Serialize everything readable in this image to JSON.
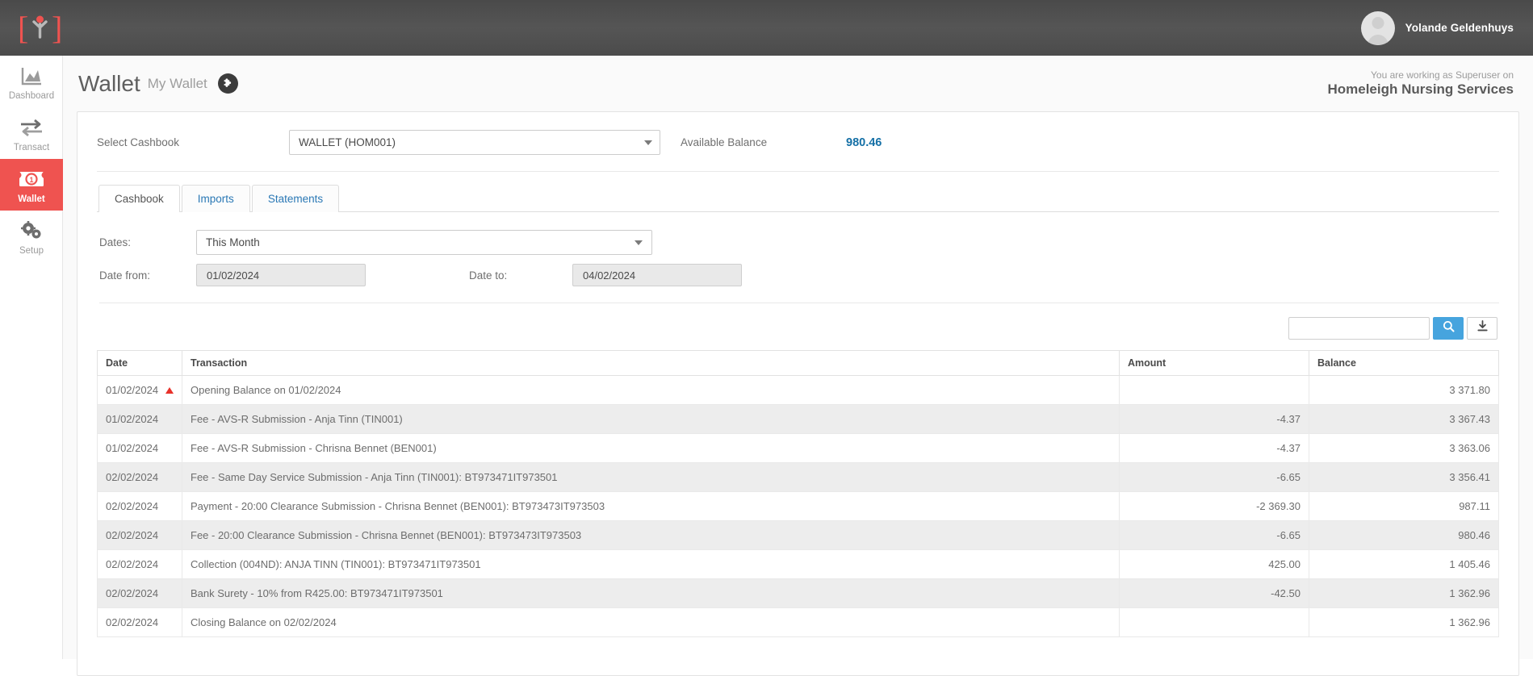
{
  "topbar": {
    "logo_icon": "sage-bracket-logo-icon",
    "user_name": "Yolande Geldenhuys",
    "avatar_icon": "user-avatar-icon"
  },
  "sidebar": {
    "items": [
      {
        "label": "Dashboard",
        "icon": "chart-area-icon",
        "active": false
      },
      {
        "label": "Transact",
        "icon": "exchange-arrows-icon",
        "active": false
      },
      {
        "label": "Wallet",
        "icon": "banknote-icon",
        "active": true
      },
      {
        "label": "Setup",
        "icon": "gears-icon",
        "active": false
      }
    ]
  },
  "page": {
    "title": "Wallet",
    "subtitle": "My Wallet",
    "badge_icon": "puzzle-piece-icon",
    "context_line1": "You are working as Superuser on",
    "context_line2": "Homeleigh Nursing Services"
  },
  "cashbook": {
    "label": "Select Cashbook",
    "selected": "WALLET (HOM001)",
    "balance_label": "Available Balance",
    "balance_value": "980.46",
    "balance_color": "#1570a6"
  },
  "tabs": [
    {
      "label": "Cashbook",
      "active": true
    },
    {
      "label": "Imports",
      "active": false
    },
    {
      "label": "Statements",
      "active": false
    }
  ],
  "filters": {
    "dates_label": "Dates:",
    "dates_value": "This Month",
    "date_from_label": "Date from:",
    "date_from_value": "01/02/2024",
    "date_to_label": "Date to:",
    "date_to_value": "04/02/2024"
  },
  "search": {
    "value": "",
    "placeholder": "",
    "search_icon": "magnifier-icon",
    "export_icon": "download-icon"
  },
  "table": {
    "columns": [
      "Date",
      "Transaction",
      "Amount",
      "Balance"
    ],
    "sort_indicator": "sort-ascending-triangle",
    "rows": [
      {
        "date": "01/02/2024",
        "transaction": "Opening Balance on 01/02/2024",
        "amount": "",
        "balance": "3 371.80",
        "sorted": true
      },
      {
        "date": "01/02/2024",
        "transaction": "Fee - AVS-R Submission - Anja Tinn (TIN001)",
        "amount": "-4.37",
        "balance": "3 367.43",
        "sorted": false
      },
      {
        "date": "01/02/2024",
        "transaction": "Fee - AVS-R Submission - Chrisna Bennet (BEN001)",
        "amount": "-4.37",
        "balance": "3 363.06",
        "sorted": false
      },
      {
        "date": "02/02/2024",
        "transaction": "Fee - Same Day Service Submission - Anja Tinn (TIN001): BT973471IT973501",
        "amount": "-6.65",
        "balance": "3 356.41",
        "sorted": false
      },
      {
        "date": "02/02/2024",
        "transaction": "Payment - 20:00 Clearance Submission - Chrisna Bennet (BEN001): BT973473IT973503",
        "amount": "-2 369.30",
        "balance": "987.11",
        "sorted": false
      },
      {
        "date": "02/02/2024",
        "transaction": "Fee - 20:00 Clearance Submission - Chrisna Bennet (BEN001): BT973473IT973503",
        "amount": "-6.65",
        "balance": "980.46",
        "sorted": false
      },
      {
        "date": "02/02/2024",
        "transaction": "Collection (004ND): ANJA TINN (TIN001): BT973471IT973501",
        "amount": "425.00",
        "balance": "1 405.46",
        "sorted": false
      },
      {
        "date": "02/02/2024",
        "transaction": "Bank Surety - 10% from R425.00: BT973471IT973501",
        "amount": "-42.50",
        "balance": "1 362.96",
        "sorted": false
      },
      {
        "date": "02/02/2024",
        "transaction": "Closing Balance on 02/02/2024",
        "amount": "",
        "balance": "1 362.96",
        "sorted": false
      }
    ]
  }
}
